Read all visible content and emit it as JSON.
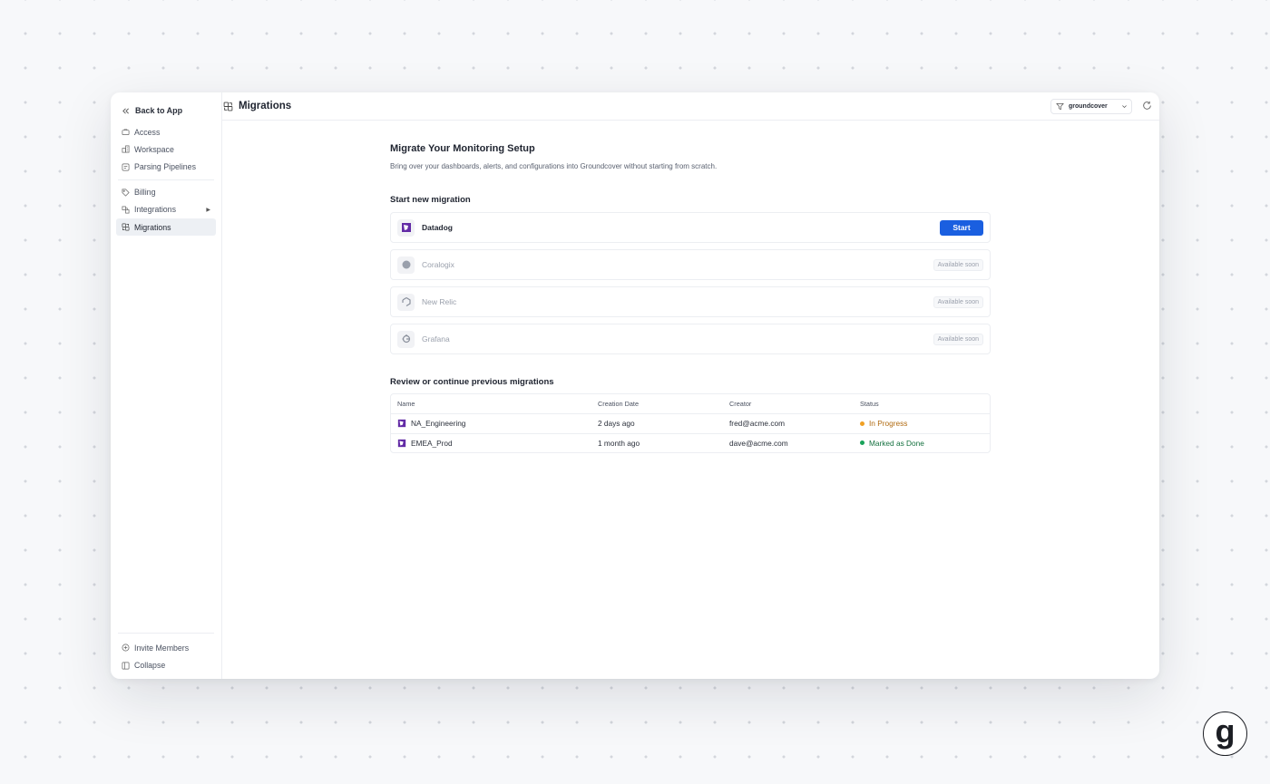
{
  "sidebar": {
    "back_label": "Back to App",
    "items_top": [
      {
        "label": "Access",
        "icon": "briefcase-icon"
      },
      {
        "label": "Workspace",
        "icon": "building-icon"
      },
      {
        "label": "Parsing Pipelines",
        "icon": "pipeline-icon"
      }
    ],
    "items_mid": [
      {
        "label": "Billing",
        "icon": "tag-icon"
      },
      {
        "label": "Integrations",
        "icon": "puzzle-icon"
      },
      {
        "label": "Migrations",
        "icon": "migration-icon"
      }
    ],
    "bottom": [
      {
        "label": "Invite Members",
        "icon": "plus-circle-icon"
      },
      {
        "label": "Collapse",
        "icon": "collapse-icon"
      }
    ]
  },
  "header": {
    "title": "Migrations",
    "workspace": "groundcover"
  },
  "main": {
    "title": "Migrate Your Monitoring Setup",
    "subtitle": "Bring over your dashboards, alerts, and configurations into Groundcover without starting from scratch.",
    "new_heading": "Start new migration",
    "sources": [
      {
        "name": "Datadog",
        "action": "Start"
      },
      {
        "name": "Coralogix",
        "badge": "Available soon"
      },
      {
        "name": "New Relic",
        "badge": "Available soon"
      },
      {
        "name": "Grafana",
        "badge": "Available soon"
      }
    ],
    "prev_heading": "Review or continue previous migrations",
    "table": {
      "columns": [
        "Name",
        "Creation Date",
        "Creator",
        "Status"
      ],
      "rows": [
        {
          "name": "NA_Engineering",
          "date": "2 days ago",
          "creator": "fred@acme.com",
          "status": "In Progress"
        },
        {
          "name": "EMEA_Prod",
          "date": "1 month ago",
          "creator": "dave@acme.com",
          "status": "Marked as Done"
        }
      ]
    }
  },
  "colors": {
    "accent": "#1a5fe0",
    "in_progress": "#f0a024",
    "done": "#19a35a",
    "datadog": "#632ca6"
  }
}
